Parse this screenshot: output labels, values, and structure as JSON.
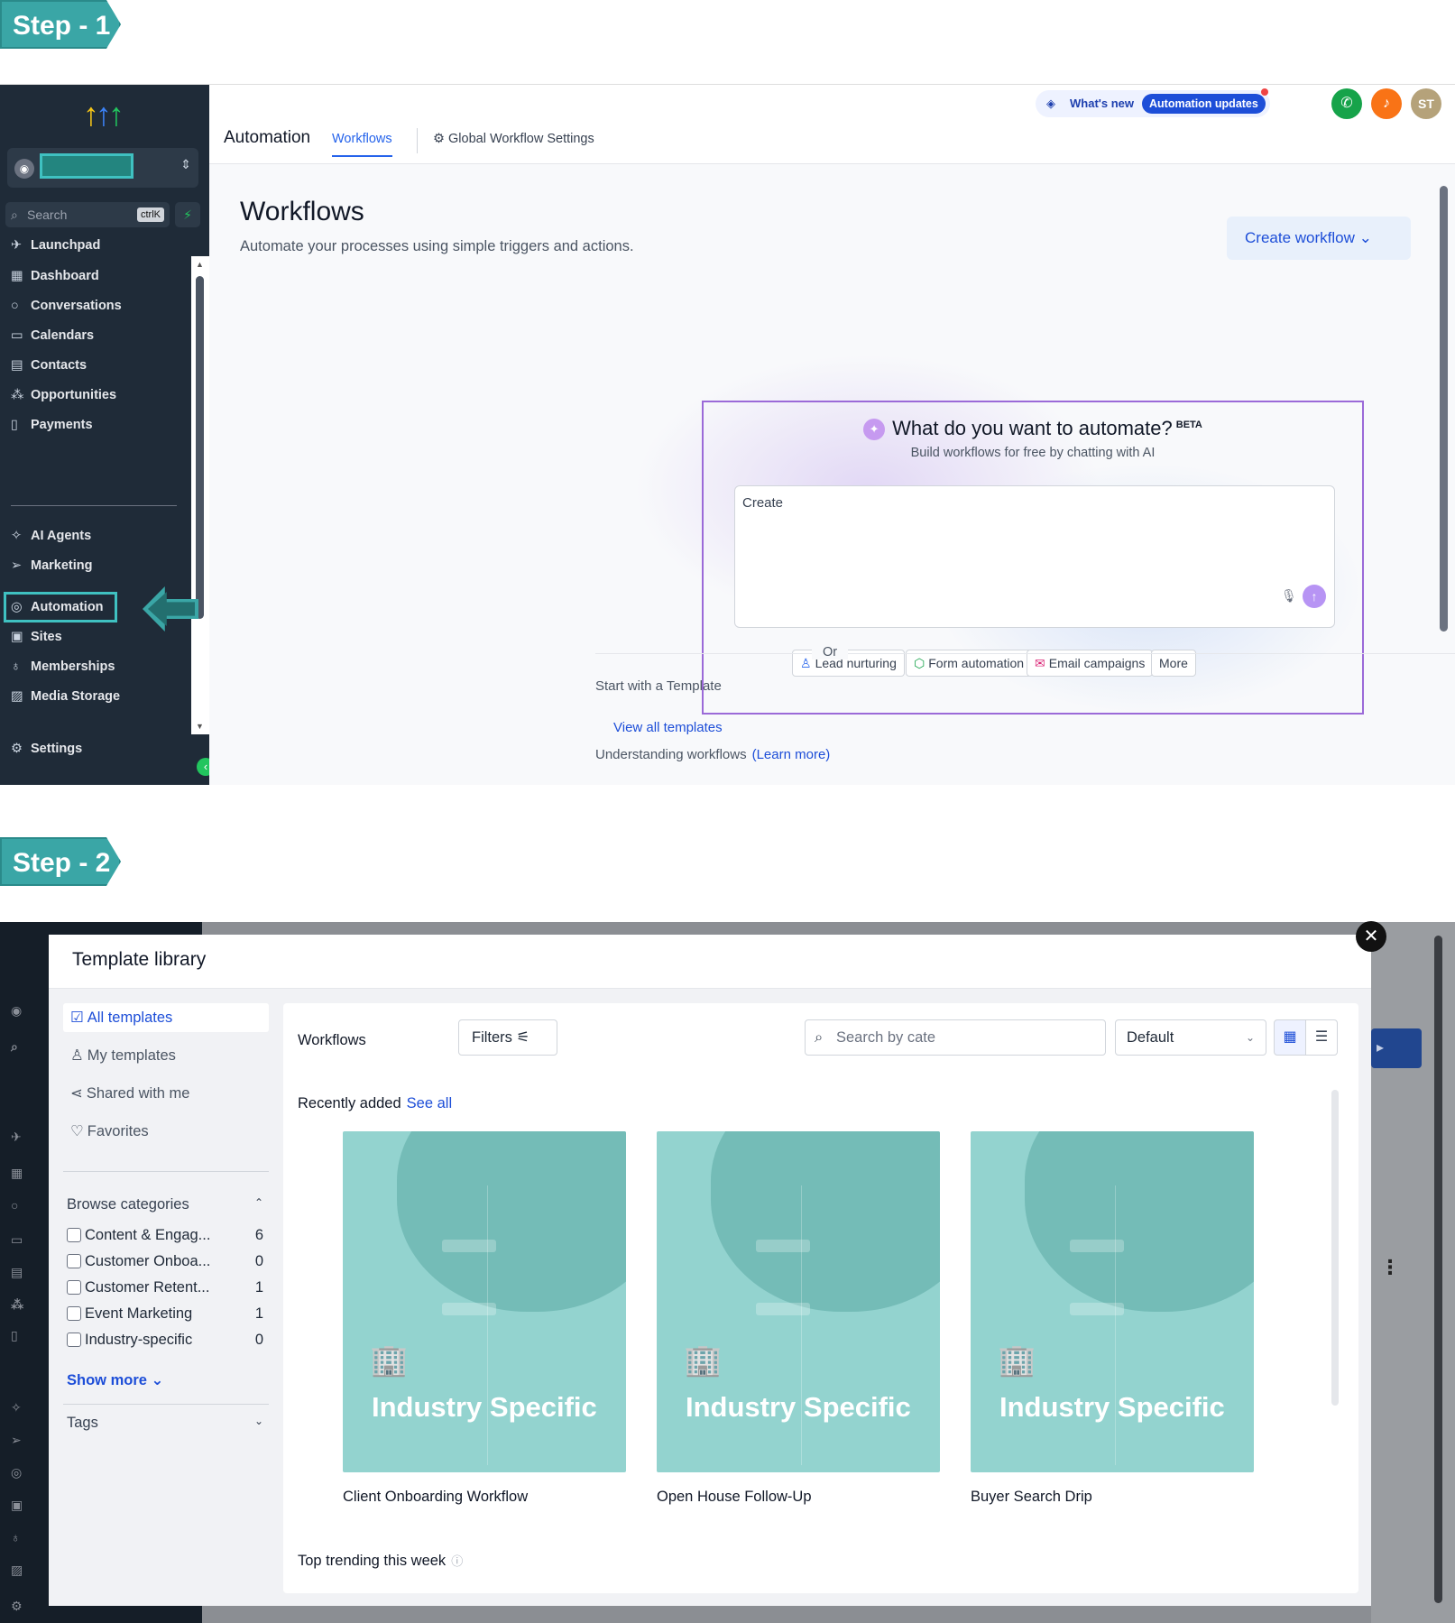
{
  "step1_label": "Step - 1",
  "step2_label": "Step - 2",
  "sidebar": {
    "search_placeholder": "Search",
    "search_shortcut": "ctrlK",
    "items": [
      {
        "label": "Launchpad",
        "icon": "rocket-icon"
      },
      {
        "label": "Dashboard",
        "icon": "grid-icon"
      },
      {
        "label": "Conversations",
        "icon": "chat-icon"
      },
      {
        "label": "Calendars",
        "icon": "calendar-icon"
      },
      {
        "label": "Contacts",
        "icon": "contacts-icon"
      },
      {
        "label": "Opportunities",
        "icon": "opportunities-icon"
      },
      {
        "label": "Payments",
        "icon": "payments-icon"
      },
      {
        "label": "AI Agents",
        "icon": "sparkle-icon"
      },
      {
        "label": "Marketing",
        "icon": "send-icon"
      },
      {
        "label": "Automation",
        "icon": "automation-icon"
      },
      {
        "label": "Sites",
        "icon": "sites-icon"
      },
      {
        "label": "Memberships",
        "icon": "badge-icon"
      },
      {
        "label": "Media Storage",
        "icon": "image-icon"
      },
      {
        "label": "Settings",
        "icon": "gear-icon"
      }
    ]
  },
  "header": {
    "whats_new": "What's new",
    "automation_updates": "Automation updates",
    "avatar_initials": "ST",
    "crumb": "Automation",
    "tab_workflows": "Workflows",
    "tab_global": "Global Workflow Settings"
  },
  "main": {
    "title": "Workflows",
    "subtitle": "Automate your processes using simple triggers and actions.",
    "create_button": "Create workflow",
    "ai_title": "What do you want to automate?",
    "ai_beta": "BETA",
    "ai_subtitle": "Build workflows for free by chatting with AI",
    "ai_placeholder": "Create",
    "chips": [
      "Lead nurturing",
      "Form automation",
      "Email campaigns",
      "More"
    ],
    "or": "Or",
    "start_template": "Start with a Template",
    "view_all": "View all templates",
    "understanding": "Understanding workflows",
    "learn_more": "(Learn more)"
  },
  "library": {
    "title": "Template library",
    "nav": [
      "All templates",
      "My templates",
      "Shared with me",
      "Favorites"
    ],
    "browse": "Browse categories",
    "categories": [
      {
        "name": "Content & Engag...",
        "count": "6"
      },
      {
        "name": "Customer Onboa...",
        "count": "0"
      },
      {
        "name": "Customer Retent...",
        "count": "1"
      },
      {
        "name": "Event Marketing",
        "count": "1"
      },
      {
        "name": "Industry-specific",
        "count": "0"
      }
    ],
    "show_more": "Show more",
    "tags": "Tags",
    "panel_title": "Workflows",
    "filters": "Filters",
    "search_placeholder": "Search by cate",
    "sort": "Default",
    "recently_added": "Recently added",
    "see_all": "See all",
    "cards": [
      {
        "label": "Industry Specific",
        "name": "Client Onboarding Workflow"
      },
      {
        "label": "Industry Specific",
        "name": "Open House Follow-Up"
      },
      {
        "label": "Industry Specific",
        "name": "Buyer Search Drip"
      }
    ],
    "trending": "Top trending this week"
  },
  "colors": {
    "accent": "#1d4ed8",
    "step_tag": "#3aa6a6",
    "sidebar_bg": "#1f2b38",
    "card_bg": "#93d3cf"
  }
}
